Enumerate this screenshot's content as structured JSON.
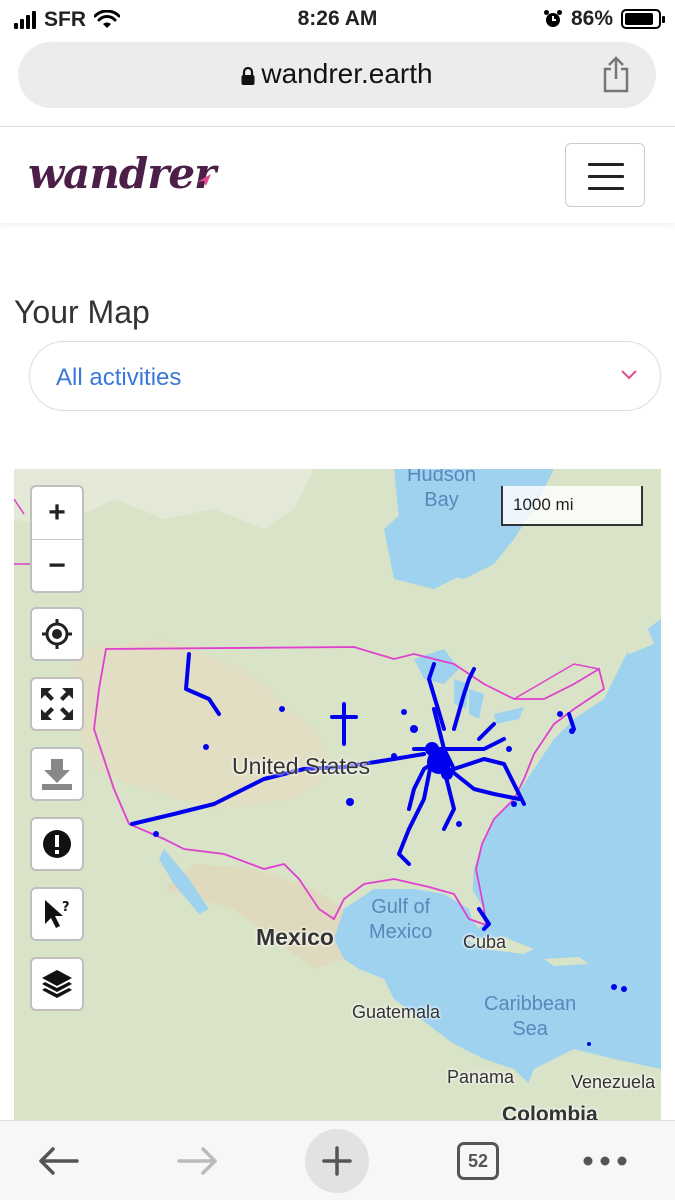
{
  "status_bar": {
    "carrier": "SFR",
    "time": "8:26 AM",
    "battery": "86%",
    "battery_level": 0.86,
    "icons": [
      "signal-icon",
      "wifi-icon",
      "alarm-icon",
      "battery-icon"
    ]
  },
  "browser": {
    "url": "wandrer.earth",
    "icons": [
      "lock-icon",
      "share-icon"
    ]
  },
  "site": {
    "logo": "wandrer",
    "menu_icon": "hamburger-menu-icon"
  },
  "page": {
    "title": "Your Map",
    "activity_filter": {
      "selected": "All activities",
      "icon": "chevron-down-icon"
    }
  },
  "map": {
    "scale": "1000 mi",
    "labels": {
      "hudson_bay_1": "Hudson",
      "hudson_bay_2": "Bay",
      "united_states": "United States",
      "gulf_1": "Gulf of",
      "gulf_2": "Mexico",
      "mexico": "Mexico",
      "cuba": "Cuba",
      "guatemala": "Guatemala",
      "caribbean_1": "Caribbean",
      "caribbean_2": "Sea",
      "panama": "Panama",
      "venezuela": "Venezuela",
      "colombia": "Colombia"
    },
    "controls": {
      "zoom_in": "+",
      "zoom_out": "−",
      "buttons": [
        "locate-icon",
        "fullscreen-icon",
        "download-icon",
        "report-icon",
        "identify-cursor-icon",
        "layers-icon"
      ]
    },
    "colors": {
      "water": "#9fd2ef",
      "land": "#d9e3c8",
      "border": "#e040d0",
      "tracks": "#0000ee"
    }
  },
  "toolbar": {
    "tab_count": "52",
    "icons": [
      "back-arrow-icon",
      "forward-arrow-icon",
      "new-tab-plus-icon",
      "tabs-icon",
      "more-icon"
    ]
  }
}
